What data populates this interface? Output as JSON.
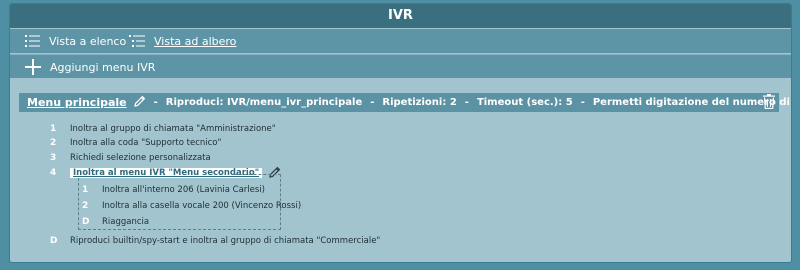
{
  "window": {
    "title": "IVR"
  },
  "toolbar": {
    "list_view_label": "Vista a elenco",
    "tree_view_label": "Vista ad albero",
    "add_menu_label": "Aggiungi menu IVR"
  },
  "main_menu": {
    "name": "Menu principale",
    "separator": "-",
    "play": "Riproduci: IVR/menu_ivr_principale",
    "repetitions": "Ripetizioni: 2",
    "timeout": "Timeout (sec.): 5",
    "digit_selection": "Permetti digitazione del numero di selezione: Sì",
    "items": [
      {
        "key": "1",
        "action": "Inoltra al gruppo di chiamata \"Amministrazione\""
      },
      {
        "key": "2",
        "action": "Inoltra alla coda \"Supporto tecnico\""
      },
      {
        "key": "3",
        "action": "Richiedi selezione personalizzata"
      },
      {
        "key": "4",
        "action": "Inoltra al menu IVR \"Menu secondario\""
      }
    ],
    "default_item": {
      "key": "D",
      "action": "Riproduci builtin/spy-start e inoltra al gruppo di chiamata \"Commerciale\""
    }
  },
  "sub_menu": {
    "items": [
      {
        "key": "1",
        "action": "Inoltra all'interno 206 (Lavinia Carlesi)"
      },
      {
        "key": "2",
        "action": "Inoltra alla casella vocale 200 (Vincenzo Rossi)"
      },
      {
        "key": "D",
        "action": "Riaggancia"
      }
    ]
  },
  "colors": {
    "title_bar": "#3a6f80",
    "toolbar": "#5d95a7",
    "panel": "#a2c4cf",
    "menu_header": "#5b93a5"
  },
  "icons": [
    "list-icon",
    "tree-icon",
    "plus-icon",
    "pencil-icon",
    "trash-icon"
  ]
}
